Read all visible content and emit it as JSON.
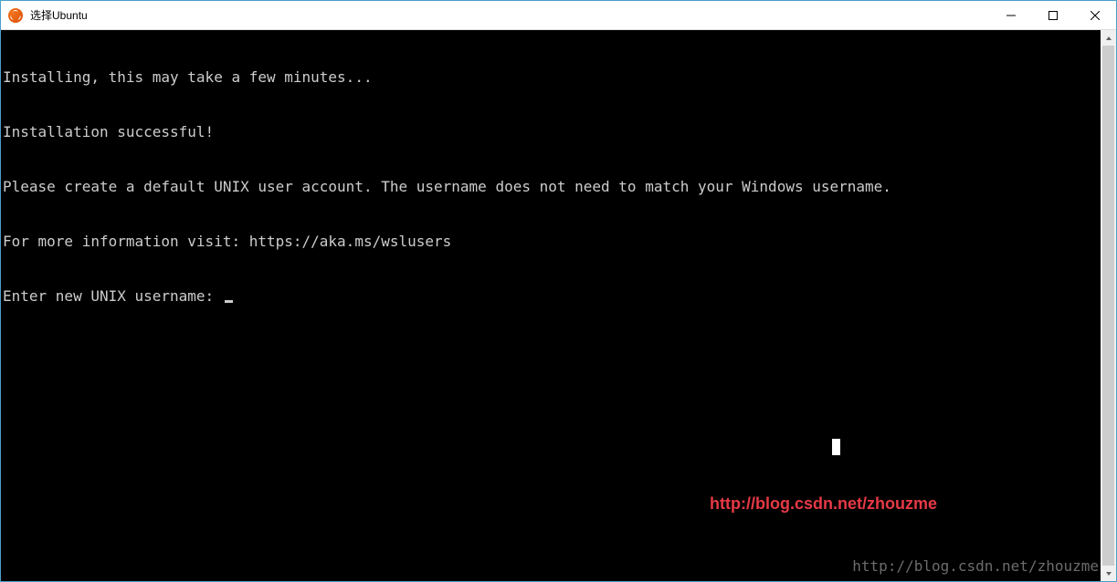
{
  "titlebar": {
    "title": "选择Ubuntu"
  },
  "terminal": {
    "lines": [
      "Installing, this may take a few minutes...",
      "Installation successful!",
      "Please create a default UNIX user account. The username does not need to match your Windows username.",
      "For more information visit: https://aka.ms/wslusers",
      "Enter new UNIX username: "
    ]
  },
  "watermarks": {
    "red": "http://blog.csdn.net/zhouzme",
    "gray": "http://blog.csdn.net/zhouzme"
  }
}
